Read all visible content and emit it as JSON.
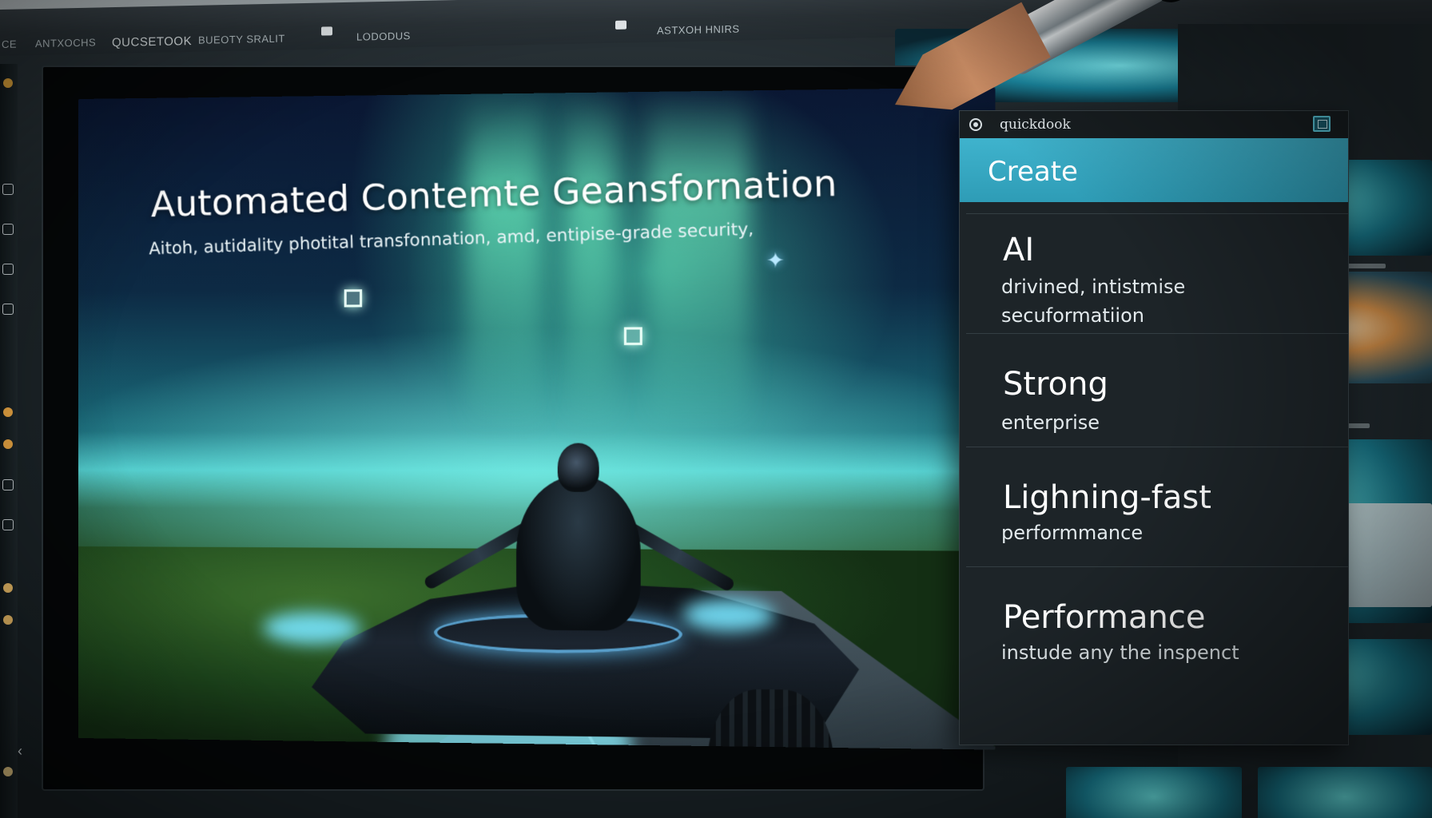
{
  "menubar": {
    "items": [
      "CE",
      "ANTXOCHS",
      "QUCSETOOK",
      "BUEOTY SRALIT",
      "LODODUS",
      "ASTXOH HNIRS"
    ]
  },
  "hero": {
    "title": "Automated Contemte Geansfornation",
    "subtitle": "Aitoh, autidality  photital transfonnation, amd, entipise-grade security,"
  },
  "panel": {
    "title": "quickdook",
    "create_label": "Create",
    "features": [
      {
        "title": "AI",
        "desc": [
          "drivined, intistmise",
          "secuformatiion"
        ]
      },
      {
        "title": "Strong",
        "desc": [
          "enterprise"
        ]
      },
      {
        "title": "Lighning-fast",
        "desc": [
          "performmance"
        ]
      },
      {
        "title": "Performance",
        "desc": [
          "instude any the inspenct"
        ]
      }
    ]
  },
  "icons": {
    "panel_radio": "radio-icon",
    "panel_maximize": "maximize-icon",
    "rail_collapse": "chevron-left-icon",
    "sparkle": "sparkle-icon"
  },
  "colors": {
    "accent": "#3fb3cd",
    "panel_bg": "#1d2428",
    "hero_teal": "#4ec7c9"
  }
}
